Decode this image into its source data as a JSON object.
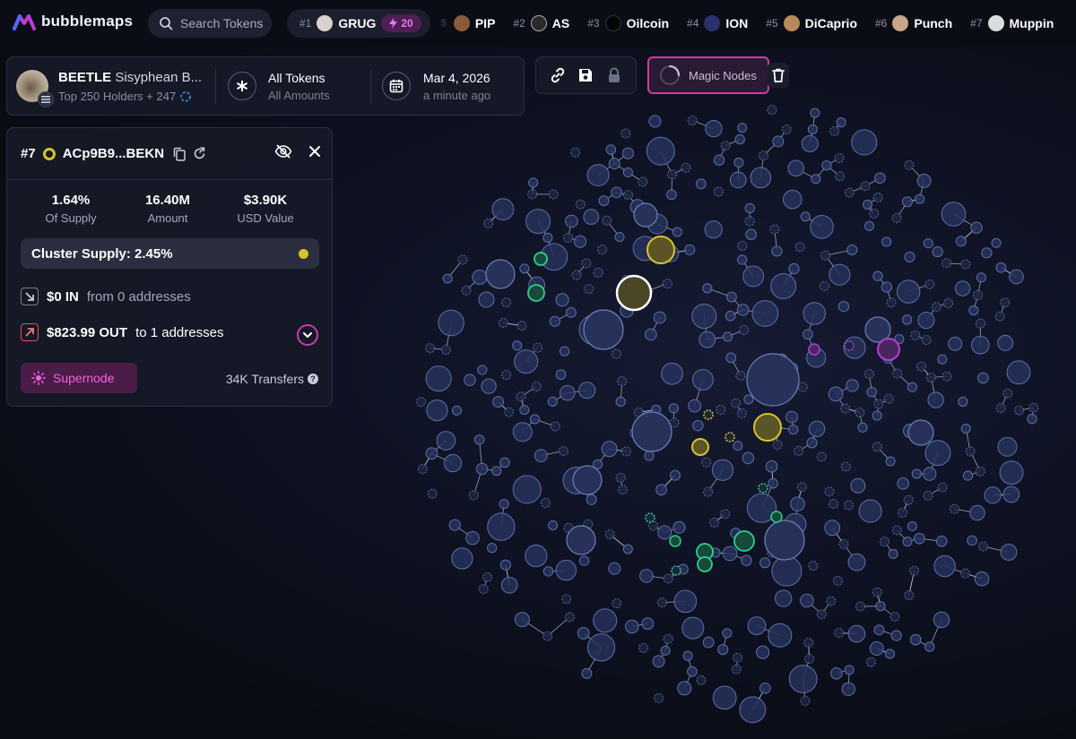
{
  "app": {
    "logo_text": "bubblemaps",
    "search_placeholder": "Search Tokens"
  },
  "trending": [
    {
      "rank": "#1",
      "name": "GRUG",
      "boost": "20",
      "avatar_color": "#d9d3cf"
    },
    {
      "rank": "",
      "name": "PIP",
      "avatar_color": "#8a5a3a"
    },
    {
      "rank": "#2",
      "name": "AS",
      "avatar_color": "#2a2a2a"
    },
    {
      "rank": "#3",
      "name": "Oilcoin",
      "avatar_color": "#0a0a0a"
    },
    {
      "rank": "#4",
      "name": "ION",
      "avatar_color": "#2b2f6b"
    },
    {
      "rank": "#5",
      "name": "DiCaprio",
      "avatar_color": "#b78a5a"
    },
    {
      "rank": "#6",
      "name": "Punch",
      "avatar_color": "#c9a58a"
    },
    {
      "rank": "#7",
      "name": "Muppin",
      "avatar_color": "#dcdce0"
    }
  ],
  "token": {
    "symbol": "BEETLE",
    "name": "Sisyphean B...",
    "holders": "Top 250 Holders + 247",
    "filter_main": "All Tokens",
    "filter_sub": "All Amounts",
    "date_main": "Mar 4, 2026",
    "date_sub": "a minute ago"
  },
  "tools": {
    "magic_label": "Magic Nodes",
    "icons": [
      "link-icon",
      "save-icon",
      "lock-icon"
    ]
  },
  "wallet": {
    "rank": "#7",
    "address": "ACp9B9...BEKN",
    "supply_value": "1.64%",
    "supply_label": "Of Supply",
    "amount_value": "16.40M",
    "amount_label": "Amount",
    "usd_value": "$3.90K",
    "usd_label": "USD Value",
    "cluster_supply": "Cluster Supply: 2.45%",
    "in_amount": "$0 IN",
    "in_desc": "from 0 addresses",
    "out_amount": "$823.99 OUT",
    "out_desc": "to 1 addresses",
    "supernode_label": "Supernode",
    "transfers": "34K Transfers"
  },
  "colors": {
    "accent_pink": "#d6399a",
    "highlight_yellow": "#d7c22a",
    "green_cluster": "#2ed08c",
    "purple_cluster": "#b23fd6",
    "node_default": "#263155"
  }
}
